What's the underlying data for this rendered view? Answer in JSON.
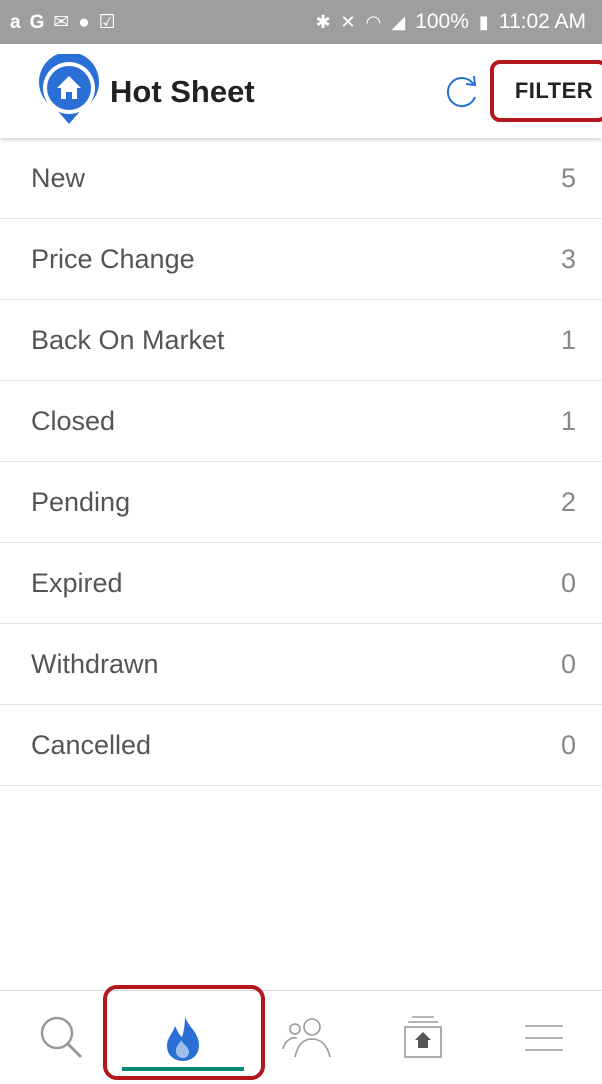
{
  "status_bar": {
    "left_icons": [
      "amazon-icon",
      "google-icon",
      "email-icon",
      "messenger-icon",
      "inbox-icon"
    ],
    "battery": "100%",
    "time": "11:02 AM"
  },
  "header": {
    "title": "Hot Sheet",
    "filter_label": "FILTER",
    "accent_color": "#2a6fd6",
    "highlight_color": "#b3161b"
  },
  "hot_sheet": {
    "items": [
      {
        "label": "New",
        "count": "5"
      },
      {
        "label": "Price Change",
        "count": "3"
      },
      {
        "label": "Back On Market",
        "count": "1"
      },
      {
        "label": "Closed",
        "count": "1"
      },
      {
        "label": "Pending",
        "count": "2"
      },
      {
        "label": "Expired",
        "count": "0"
      },
      {
        "label": "Withdrawn",
        "count": "0"
      },
      {
        "label": "Cancelled",
        "count": "0"
      }
    ]
  },
  "bottom_nav": {
    "items": [
      {
        "name": "search",
        "icon": "search-icon"
      },
      {
        "name": "hot-sheet",
        "icon": "flame-icon",
        "active": true
      },
      {
        "name": "contacts",
        "icon": "people-icon"
      },
      {
        "name": "listings",
        "icon": "house-folder-icon"
      },
      {
        "name": "menu",
        "icon": "hamburger-menu-icon"
      }
    ],
    "active_color": "#00897b"
  }
}
